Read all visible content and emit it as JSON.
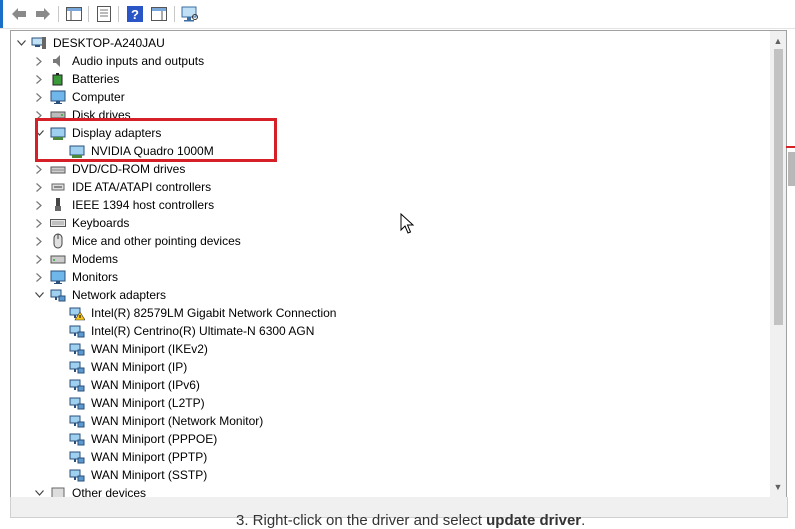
{
  "window": {
    "computer_name": "DESKTOP-A240JAU"
  },
  "toolbar": {
    "buttons": [
      "back-icon",
      "forward-icon",
      "properties-icon",
      "show-hide-console-tree-icon",
      "help-icon",
      "action-pane-icon",
      "scan-hardware-icon"
    ]
  },
  "tree": {
    "root": "DESKTOP-A240JAU",
    "categories": [
      {
        "label": "Audio inputs and outputs",
        "expanded": false
      },
      {
        "label": "Batteries",
        "expanded": false
      },
      {
        "label": "Computer",
        "expanded": false
      },
      {
        "label": "Disk drives",
        "expanded": false
      },
      {
        "label": "Display adapters",
        "expanded": true,
        "children": [
          "NVIDIA Quadro 1000M"
        ]
      },
      {
        "label": "DVD/CD-ROM drives",
        "expanded": false
      },
      {
        "label": "IDE ATA/ATAPI controllers",
        "expanded": false
      },
      {
        "label": "IEEE 1394 host controllers",
        "expanded": false
      },
      {
        "label": "Keyboards",
        "expanded": false
      },
      {
        "label": "Mice and other pointing devices",
        "expanded": false
      },
      {
        "label": "Modems",
        "expanded": false
      },
      {
        "label": "Monitors",
        "expanded": false
      },
      {
        "label": "Network adapters",
        "expanded": true,
        "children": [
          "Intel(R) 82579LM Gigabit Network Connection",
          "Intel(R) Centrino(R) Ultimate-N 6300 AGN",
          "WAN Miniport (IKEv2)",
          "WAN Miniport (IP)",
          "WAN Miniport (IPv6)",
          "WAN Miniport (L2TP)",
          "WAN Miniport (Network Monitor)",
          "WAN Miniport (PPPOE)",
          "WAN Miniport (PPTP)",
          "WAN Miniport (SSTP)"
        ]
      },
      {
        "label": "Other devices",
        "expanded": true
      }
    ]
  },
  "caption": {
    "prefix": "3. Right-click on the driver and select ",
    "bold": "update driver",
    "suffix": "."
  },
  "colors": {
    "highlight": "#d62027",
    "accent": "#1c6fc7"
  }
}
